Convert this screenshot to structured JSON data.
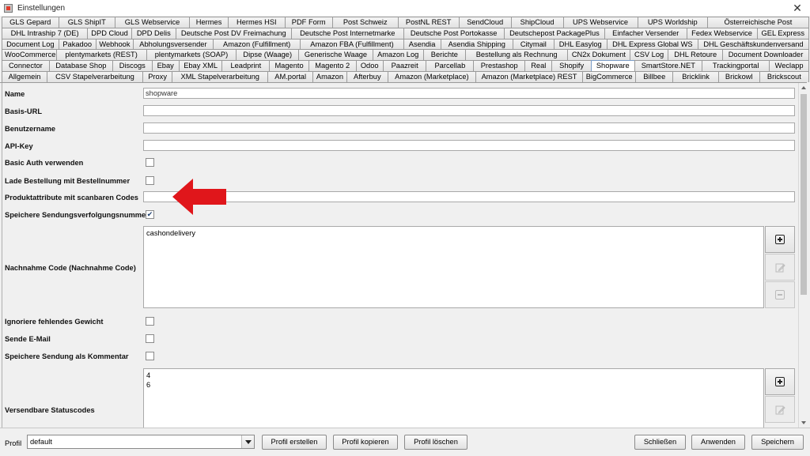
{
  "window": {
    "title": "Einstellungen"
  },
  "tab_rows": [
    [
      "GLS Gepard",
      "GLS ShipIT",
      "GLS Webservice",
      "Hermes",
      "Hermes HSI",
      "PDF Form",
      "Post Schweiz",
      "PostNL REST",
      "SendCloud",
      "ShipCloud",
      "UPS Webservice",
      "UPS Worldship",
      "Österreichische Post"
    ],
    [
      "DHL Intraship 7 (DE)",
      "DPD Cloud",
      "DPD Delis",
      "Deutsche Post DV Freimachung",
      "Deutsche Post Internetmarke",
      "Deutsche Post Portokasse",
      "Deutschepost PackagePlus",
      "Einfacher Versender",
      "Fedex Webservice",
      "GEL Express"
    ],
    [
      "Document Log",
      "Pakadoo",
      "Webhook",
      "Abholungsversender",
      "Amazon (Fulfillment)",
      "Amazon FBA (Fulfillment)",
      "Asendia",
      "Asendia Shipping",
      "Citymail",
      "DHL Easylog",
      "DHL Express Global WS",
      "DHL Geschäftskundenversand"
    ],
    [
      "WooCommerce",
      "plentymarkets (REST)",
      "plentymarkets (SOAP)",
      "Dipse (Waage)",
      "Generische Waage",
      "Amazon Log",
      "Berichte",
      "Bestellung als Rechnung",
      "CN2x Dokument",
      "CSV Log",
      "DHL Retoure",
      "Document Downloader"
    ],
    [
      "Connector",
      "Database Shop",
      "Discogs",
      "Ebay",
      "Ebay XML",
      "Leadprint",
      "Magento",
      "Magento 2",
      "Odoo",
      "Paazreit",
      "Parcellab",
      "Prestashop",
      "Real",
      "Shopify",
      "Shopware",
      "SmartStore.NET",
      "Trackingportal",
      "Weclapp"
    ],
    [
      "Allgemein",
      "CSV Stapelverarbeitung",
      "Proxy",
      "XML Stapelverarbeitung",
      "AM.portal",
      "Amazon",
      "Afterbuy",
      "Amazon (Marketplace)",
      "Amazon (Marketplace) REST",
      "BigCommerce",
      "Billbee",
      "Bricklink",
      "Brickowl",
      "Brickscout"
    ]
  ],
  "active_tab": "Shopware",
  "form": {
    "name_label": "Name",
    "name_value": "shopware",
    "basis_url_label": "Basis-URL",
    "basis_url_value": "",
    "benutzername_label": "Benutzername",
    "benutzername_value": "",
    "api_key_label": "API-Key",
    "api_key_value": "",
    "basic_auth_label": "Basic Auth verwenden",
    "basic_auth_checked": false,
    "lade_bestellung_label": "Lade Bestellung mit Bestellnummer",
    "lade_bestellung_checked": false,
    "produktattribute_label": "Produktattribute mit scanbaren Codes",
    "produktattribute_value": "",
    "speichere_sendung_label": "Speichere Sendungsverfolgungsnummer",
    "speichere_sendung_checked": true,
    "checkmark": "✔",
    "nachnahme_label": "Nachnahme Code (Nachnahme Code)",
    "nachnahme_values": [
      "cashondelivery"
    ],
    "ignoriere_gewicht_label": "Ignoriere fehlendes Gewicht",
    "ignoriere_gewicht_checked": false,
    "sende_email_label": "Sende E-Mail",
    "sende_email_checked": false,
    "speichere_kommentar_label": "Speichere Sendung als Kommentar",
    "speichere_kommentar_checked": false,
    "statuscodes_label": "Versendbare Statuscodes",
    "statuscodes_values": [
      "4",
      "6"
    ]
  },
  "annotation": {
    "color": "#e0161b",
    "icon": "red-arrow-left"
  },
  "bottom": {
    "profil_label": "Profil",
    "profil_value": "default",
    "profil_erstellen": "Profil erstellen",
    "profil_kopieren": "Profil kopieren",
    "profil_loeschen": "Profil löschen",
    "schliessen": "Schließen",
    "anwenden": "Anwenden",
    "speichern": "Speichern"
  }
}
